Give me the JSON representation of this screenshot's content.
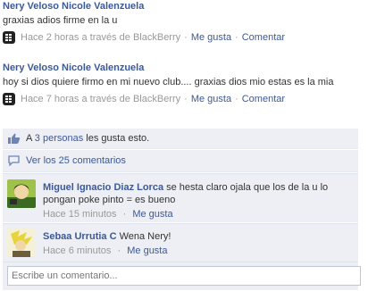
{
  "posts": [
    {
      "author": "Nery Veloso Nicole Valenzuela",
      "text": "graxias adios firme en la u",
      "time": "Hace 2 horas a través de BlackBerry",
      "like": "Me gusta",
      "comment": "Comentar"
    },
    {
      "author": "Nery Veloso Nicole Valenzuela",
      "text": "hoy si dios quiere firmo en mi nuevo club.... graxias dios mio estas es la mia",
      "time": "Hace 7 horas a través de BlackBerry",
      "like": "Me gusta",
      "comment": "Comentar"
    }
  ],
  "likes": {
    "prefix": "A ",
    "people": "3 personas",
    "suffix": " les gusta esto."
  },
  "view_comments": "Ver los 25 comentarios",
  "comments": [
    {
      "name": "Miguel Ignacio Diaz Lorca",
      "text": " se hesta claro ojala que los de la u lo pongan poke pinto = es bueno",
      "time": "Hace 15 minutos",
      "like": "Me gusta"
    },
    {
      "name": "Sebaa Urrutia C",
      "text": " Wena Nery!",
      "time": "Hace 6 minutos",
      "like": "Me gusta"
    }
  ],
  "comment_input": {
    "placeholder": "Escribe un comentario..."
  },
  "separator": "·"
}
